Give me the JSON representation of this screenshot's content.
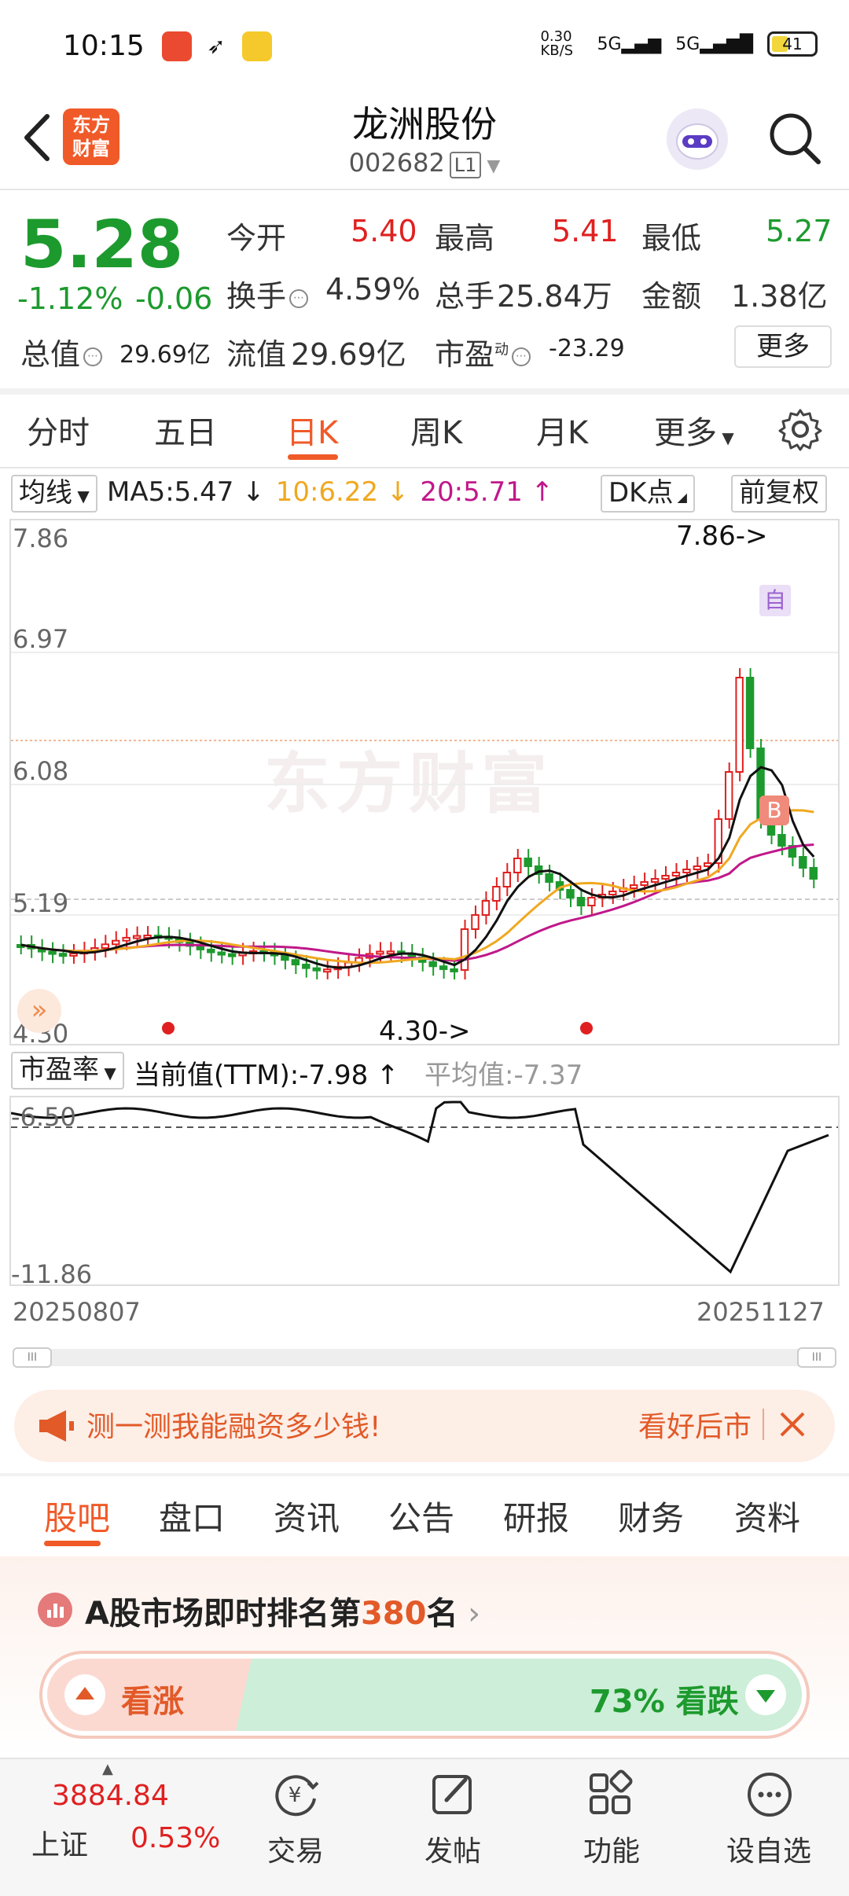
{
  "status_bar": {
    "time": "10:15",
    "net_speed": "0.30 KB/S",
    "signal1": "5G",
    "signal2": "5G",
    "battery": "41"
  },
  "header": {
    "title": "龙洲股份",
    "code": "002682",
    "level": "L1",
    "logo_text": "东方\n财富"
  },
  "quote": {
    "price": "5.28",
    "change_pct": "-1.12%",
    "change": "-0.06",
    "open_label": "今开",
    "open": "5.40",
    "high_label": "最高",
    "high": "5.41",
    "low_label": "最低",
    "low": "5.27",
    "turnover_label": "换手",
    "turnover": "4.59%",
    "volume_label": "总手",
    "volume": "25.84万",
    "amount_label": "金额",
    "amount": "1.38亿",
    "mktcap_label": "总值",
    "mktcap": "29.69亿",
    "float_label": "流值",
    "float_cap": "29.69亿",
    "pe_label": "市盈",
    "pe_sup": "动",
    "pe": "-23.29",
    "more": "更多"
  },
  "period_tabs": [
    "分时",
    "五日",
    "日K",
    "周K",
    "月K",
    "更多"
  ],
  "active_period": "日K",
  "indicator": {
    "ma_label": "均线",
    "ma5": "MA5:5.47",
    "ma10": "10:6.22",
    "ma20": "20:5.71",
    "dk": "DK点",
    "fq": "前复权"
  },
  "kline": {
    "y_labels": [
      "7.86",
      "6.97",
      "6.08",
      "5.19",
      "4.30"
    ],
    "high_marker": "7.86->",
    "low_marker": "4.30->",
    "sig_auto": "自",
    "sig_buy": "B",
    "watermark": "东方财富",
    "colors": {
      "up": "#e02020",
      "down": "#1d9a2e",
      "ma5": "#111111",
      "ma10": "#f0a820",
      "ma20": "#c0188a"
    }
  },
  "pe_chart": {
    "label": "市盈率",
    "current": "当前值(TTM):-7.98",
    "average": "平均值:-7.37",
    "y_labels": [
      "-6.50",
      "-11.86"
    ]
  },
  "dates": {
    "start": "20250807",
    "end": "20251127"
  },
  "banner": {
    "text": "测一测我能融资多少钱!",
    "right": "看好后市"
  },
  "section_tabs": [
    "股吧",
    "盘口",
    "资讯",
    "公告",
    "研报",
    "财务",
    "资料"
  ],
  "active_section": "股吧",
  "rank": {
    "prefix": "A股市场即时排名第",
    "number": "380",
    "suffix": "名"
  },
  "vote": {
    "up_label": "看涨",
    "down_label": "73% 看跌",
    "down_fraction": 0.73
  },
  "bottom_nav": {
    "index_value": "3884.84",
    "index_name": "上证",
    "index_pct": "0.53%",
    "items": [
      "交易",
      "发帖",
      "功能",
      "设自选"
    ]
  }
}
